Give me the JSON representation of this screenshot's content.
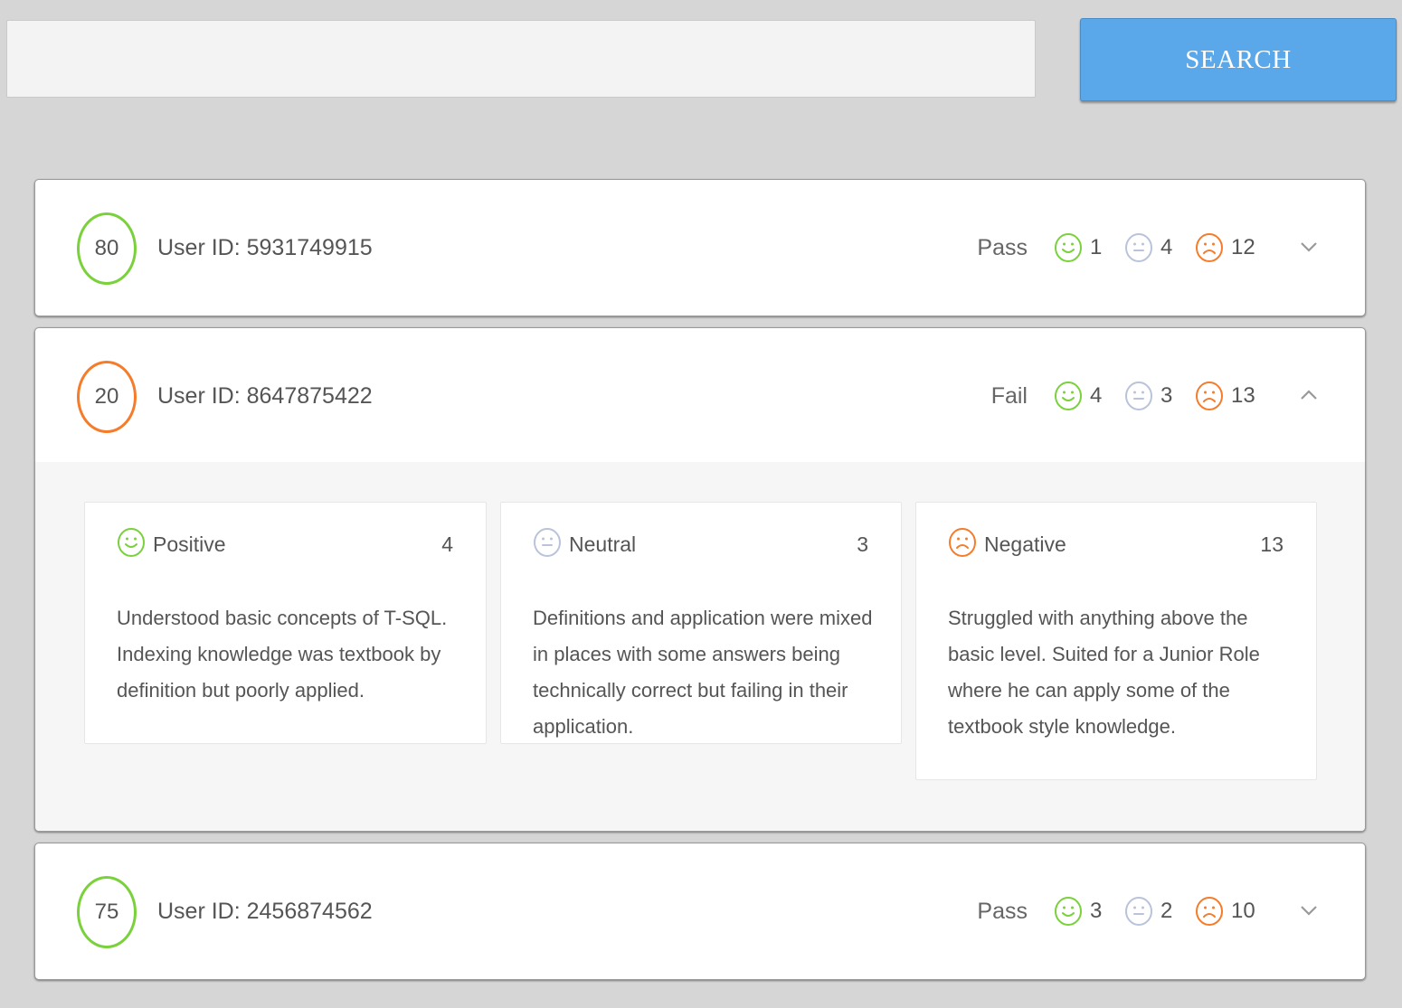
{
  "search": {
    "placeholder": "",
    "value": "",
    "button_label": "SEARCH"
  },
  "colors": {
    "positive": "#7ad13c",
    "neutral": "#b9c3d9",
    "negative": "#f57c2a",
    "button": "#5aa8ea"
  },
  "icons": {
    "positive": "smiley-icon",
    "neutral": "neutral-face-icon",
    "negative": "frown-icon",
    "collapsed": "chevron-down-icon",
    "expanded": "chevron-up-icon"
  },
  "results": [
    {
      "score": "80",
      "user_id": "User ID: 5931749915",
      "status": "Pass",
      "positive": "1",
      "neutral": "4",
      "negative": "12",
      "expanded": false
    },
    {
      "score": "20",
      "user_id": "User ID: 8647875422",
      "status": "Fail",
      "positive": "4",
      "neutral": "3",
      "negative": "13",
      "expanded": true,
      "details": [
        {
          "label": "Positive",
          "count": "4",
          "text": "Understood basic concepts of T-SQL. Indexing knowledge was textbook by definition but poorly applied."
        },
        {
          "label": "Neutral",
          "count": "3",
          "text": "Definitions and application were mixed in places with some answers being technically correct but failing in their application."
        },
        {
          "label": "Negative",
          "count": "13",
          "text": "Struggled with anything above the basic level. Suited for a Junior Role where he can apply some of the textbook style knowledge."
        }
      ]
    },
    {
      "score": "75",
      "user_id": "User ID: 2456874562",
      "status": "Pass",
      "positive": "3",
      "neutral": "2",
      "negative": "10",
      "expanded": false
    }
  ]
}
